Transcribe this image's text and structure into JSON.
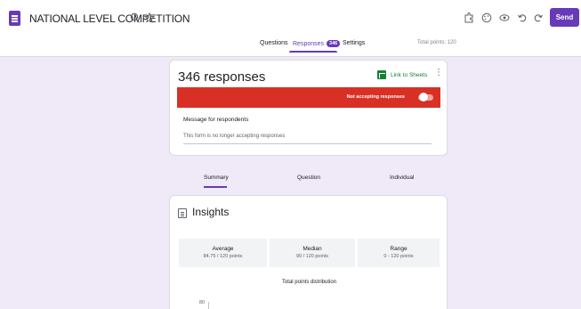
{
  "header": {
    "title": "NATIONAL LEVEL COMPETITION",
    "send_label": "Send"
  },
  "tabs": [
    {
      "label": "Questions"
    },
    {
      "label": "Responses",
      "badge": "346"
    },
    {
      "label": "Settings"
    }
  ],
  "total_points": "Total points: 120",
  "responses_card": {
    "title": "346 responses",
    "link_label": "Link to Sheets",
    "status_label": "Not accepting responses",
    "message_label": "Message for respondents",
    "message_value": "This form is no longer accepting responses"
  },
  "subtabs": [
    {
      "label": "Summary"
    },
    {
      "label": "Question"
    },
    {
      "label": "Individual"
    }
  ],
  "insights": {
    "title": "Insights",
    "stats": [
      {
        "name": "Average",
        "value": "84.75 / 120 points"
      },
      {
        "name": "Median",
        "value": "90 / 120 points"
      },
      {
        "name": "Range",
        "value": "0 - 120 points"
      }
    ],
    "distribution_title": "Total points distribution",
    "y_axis_top": "80"
  },
  "colors": {
    "accent": "#673ab7",
    "alert": "#d93025",
    "sheets": "#188038"
  }
}
